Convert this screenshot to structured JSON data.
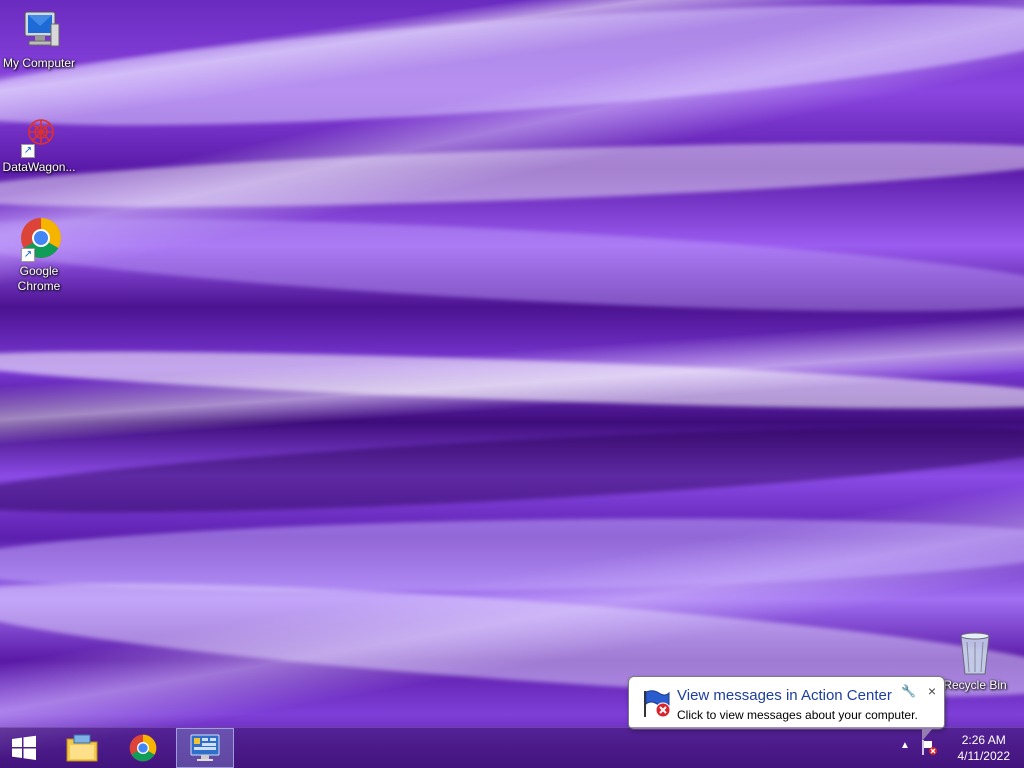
{
  "desktop": {
    "icons": [
      {
        "label": "My Computer",
        "icon": "computer-icon"
      },
      {
        "label": "DataWagon...",
        "icon": "datawagon-icon"
      },
      {
        "label": "Google Chrome",
        "icon": "chrome-icon"
      },
      {
        "label": "Recycle Bin",
        "icon": "recycle-bin-icon"
      }
    ]
  },
  "taskbar": {
    "buttons": [
      {
        "icon": "windows-start-icon"
      },
      {
        "icon": "file-explorer-icon"
      },
      {
        "icon": "chrome-icon"
      },
      {
        "icon": "server-manager-icon",
        "active": true
      }
    ],
    "tray": {
      "up_arrow": "▲",
      "action_center_icon": "action-center-flag-icon"
    },
    "clock": {
      "time": "2:26 AM",
      "date": "4/11/2022"
    }
  },
  "balloon": {
    "title": "View messages in Action Center",
    "text": "Click to view messages about your computer.",
    "close": "×"
  },
  "colors": {
    "wallpaper": "#6a2bc0",
    "balloon_title": "#1e3e9e",
    "taskbar": "#3c146e"
  }
}
